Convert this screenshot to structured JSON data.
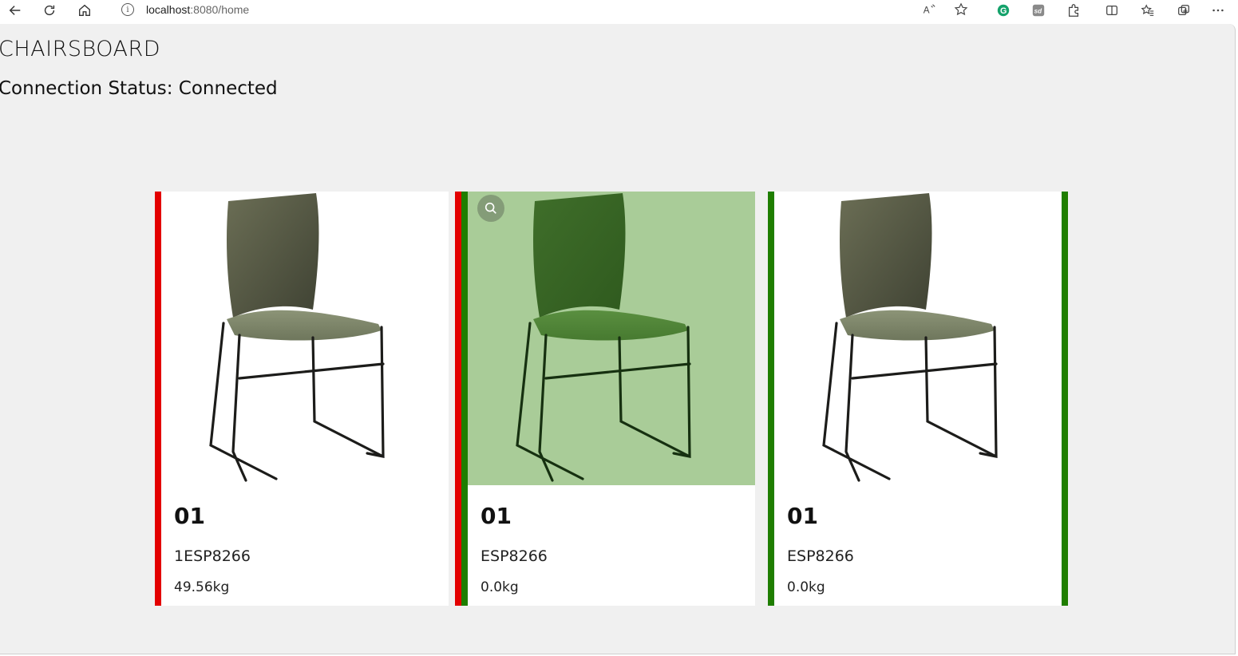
{
  "browser": {
    "url_host": "localhost",
    "url_path": ":8080/home",
    "icons": [
      "back-icon",
      "refresh-icon",
      "home-icon",
      "info-icon",
      "read-aloud-icon",
      "favorite-star-icon",
      "grammarly-icon",
      "sd-extension-icon",
      "extensions-icon",
      "split-screen-icon",
      "favorites-icon",
      "collections-icon",
      "more-icon"
    ]
  },
  "page": {
    "title": "CHAIRSBOARD",
    "status": "Connection Status: Connected"
  },
  "colors": {
    "occupied": "#e30000",
    "free": "#1f7e00",
    "highlight": "#a9cc98",
    "background": "#f0f0f0"
  },
  "cards": [
    {
      "id": "01",
      "device": "1ESP8266",
      "weight": "49.56kg",
      "status": "red"
    },
    {
      "id": "01",
      "device": "ESP8266",
      "weight": "0.0kg",
      "status": "green"
    },
    {
      "id": "01",
      "device": "ESP8266",
      "weight": "0.0kg",
      "status": "green"
    }
  ]
}
